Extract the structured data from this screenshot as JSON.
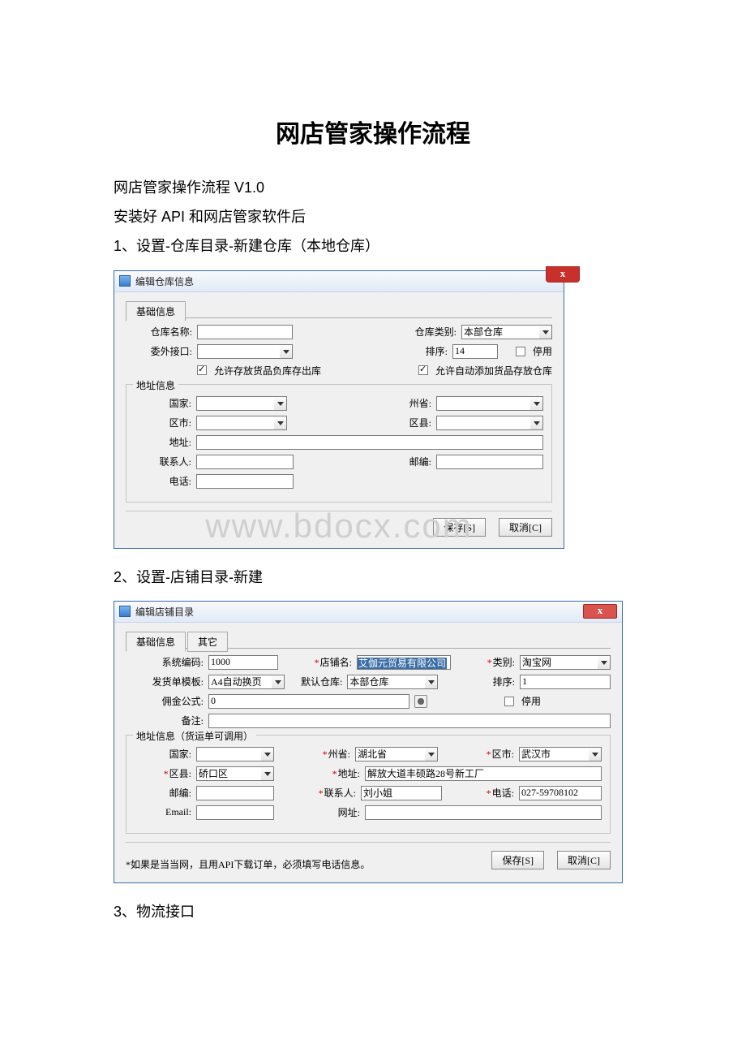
{
  "doc": {
    "title": "网店管家操作流程",
    "p1": "网店管家操作流程 V1.0",
    "p2": "安装好 API 和网店管家软件后",
    "step1": "1、设置-仓库目录-新建仓库（本地仓库）",
    "step2": "2、设置-店铺目录-新建",
    "step3": "3、物流接口",
    "watermark": "www.bdocx.com"
  },
  "dlg1": {
    "title": "编辑仓库信息",
    "close": "x",
    "tab_basic": "基础信息",
    "warehouse_name_lbl": "仓库名称:",
    "warehouse_type_lbl": "仓库类别:",
    "warehouse_type_val": "本部仓库",
    "outsource_lbl": "委外接口:",
    "sort_lbl": "排序:",
    "sort_val": "14",
    "disable_lbl": "停用",
    "allow_neg_lbl": "允许存放货品负库存出库",
    "auto_add_lbl": "允许自动添加货品存放仓库",
    "addr_grp": "地址信息",
    "country_lbl": "国家:",
    "province_lbl": "州省:",
    "city_lbl": "区市:",
    "district_lbl": "区县:",
    "address_lbl": "地址:",
    "contact_lbl": "联系人:",
    "zip_lbl": "邮编:",
    "phone_lbl": "电话:",
    "save_btn": "保存[S]",
    "cancel_btn": "取消[C]"
  },
  "dlg2": {
    "title": "编辑店铺目录",
    "close": "x",
    "tab_basic": "基础信息",
    "tab_other": "其它",
    "syscode_lbl": "系统编码:",
    "syscode_val": "1000",
    "shopname_lbl": "店铺名:",
    "shopname_val": "艾伽元贸易有限公司",
    "category_lbl": "类别:",
    "category_val": "淘宝网",
    "template_lbl": "发货单模板:",
    "template_val": "A4自动换页",
    "default_wh_lbl": "默认仓库:",
    "default_wh_val": "本部仓库",
    "sort_lbl": "排序:",
    "sort_val": "1",
    "comm_lbl": "佣金公式:",
    "comm_val": "0",
    "disable_lbl": "停用",
    "remark_lbl": "备注:",
    "addr_grp": "地址信息（货运单可调用）",
    "country_lbl": "国家:",
    "province_lbl": "州省:",
    "province_val": "湖北省",
    "city_lbl": "区市:",
    "city_val": "武汉市",
    "district_lbl": "区县:",
    "district_val": "硚口区",
    "addr_lbl": "地址:",
    "addr_val": "解放大道丰硕路28号新工厂",
    "zip_lbl": "邮编:",
    "contact_lbl": "联系人:",
    "contact_val": "刘小姐",
    "phone_lbl": "电话:",
    "phone_val": "027-59708102",
    "email_lbl": "Email:",
    "url_lbl": "网址:",
    "note": "*如果是当当网，且用API下载订单，必须填写电话信息。",
    "save_btn": "保存[S]",
    "cancel_btn": "取消[C]"
  }
}
